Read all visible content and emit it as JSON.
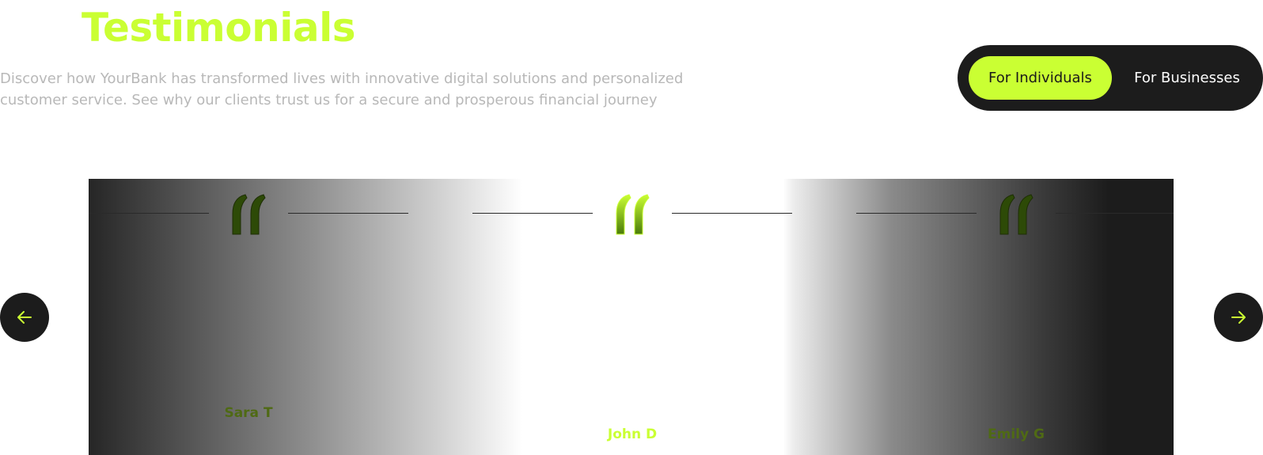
{
  "header": {
    "title": "Testimonials",
    "description": "Discover how YourBank has transformed lives with innovative digital solutions and personalized customer service. See why our clients trust us for a secure and prosperous financial journey"
  },
  "toggle": {
    "active_label": "For Individuals",
    "inactive_label": "For Businesses"
  },
  "testimonials": [
    {
      "name": "Sara T"
    },
    {
      "name": "John D"
    },
    {
      "name": "Emily G"
    }
  ],
  "icons": {
    "prev": "arrow-left-icon",
    "next": "arrow-right-icon",
    "quote": "quote-icon"
  },
  "colors": {
    "accent": "#caff33",
    "dark": "#1c1c1c",
    "muted_text": "#b8b8b8"
  }
}
